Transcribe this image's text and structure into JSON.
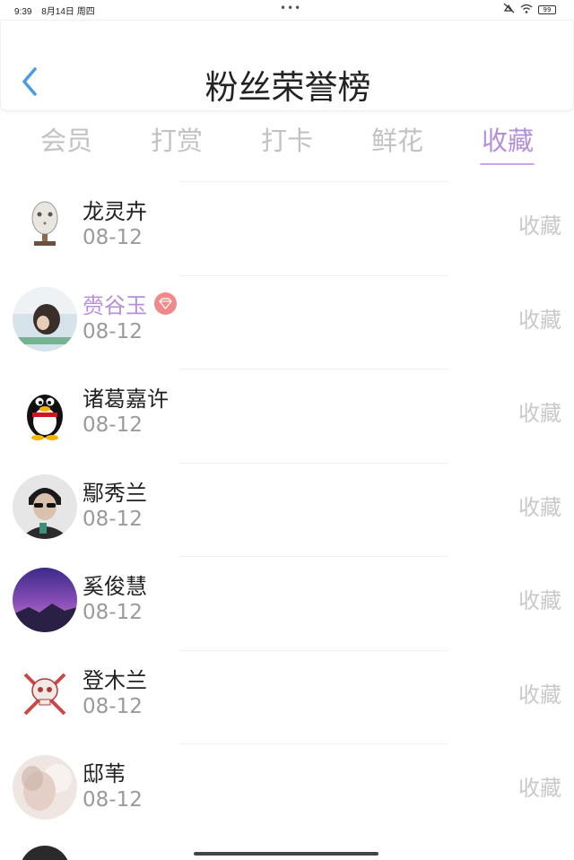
{
  "status_bar": {
    "time": "9:39",
    "date": "8月14日 周四",
    "dots": "•••",
    "battery": "99"
  },
  "header": {
    "title": "粉丝荣誉榜"
  },
  "tabs": [
    {
      "label": "会员"
    },
    {
      "label": "打赏"
    },
    {
      "label": "打卡"
    },
    {
      "label": "鲜花"
    },
    {
      "label": "收藏"
    }
  ],
  "active_tab": "收藏",
  "colors": {
    "accent": "#b58fd8",
    "inactive_tab": "#c2c2c2",
    "badge": "#f08a8a"
  },
  "fans": [
    {
      "name": "龙灵卉",
      "date": "08-12",
      "action": "收藏",
      "avatar": "hockey-mask-avatar"
    },
    {
      "name": "赍谷玉",
      "date": "08-12",
      "action": "收藏",
      "vip": true,
      "avatar": "girl-photo-avatar"
    },
    {
      "name": "诸葛嘉许",
      "date": "08-12",
      "action": "收藏",
      "avatar": "penguin-avatar"
    },
    {
      "name": "鄢秀兰",
      "date": "08-12",
      "action": "收藏",
      "avatar": "sunglasses-man-avatar"
    },
    {
      "name": "奚俊慧",
      "date": "08-12",
      "action": "收藏",
      "avatar": "purple-sky-avatar"
    },
    {
      "name": "登木兰",
      "date": "08-12",
      "action": "收藏",
      "avatar": "skull-avatar"
    },
    {
      "name": "邸苇",
      "date": "08-12",
      "action": "收藏",
      "avatar": "blurred-face-avatar"
    }
  ]
}
